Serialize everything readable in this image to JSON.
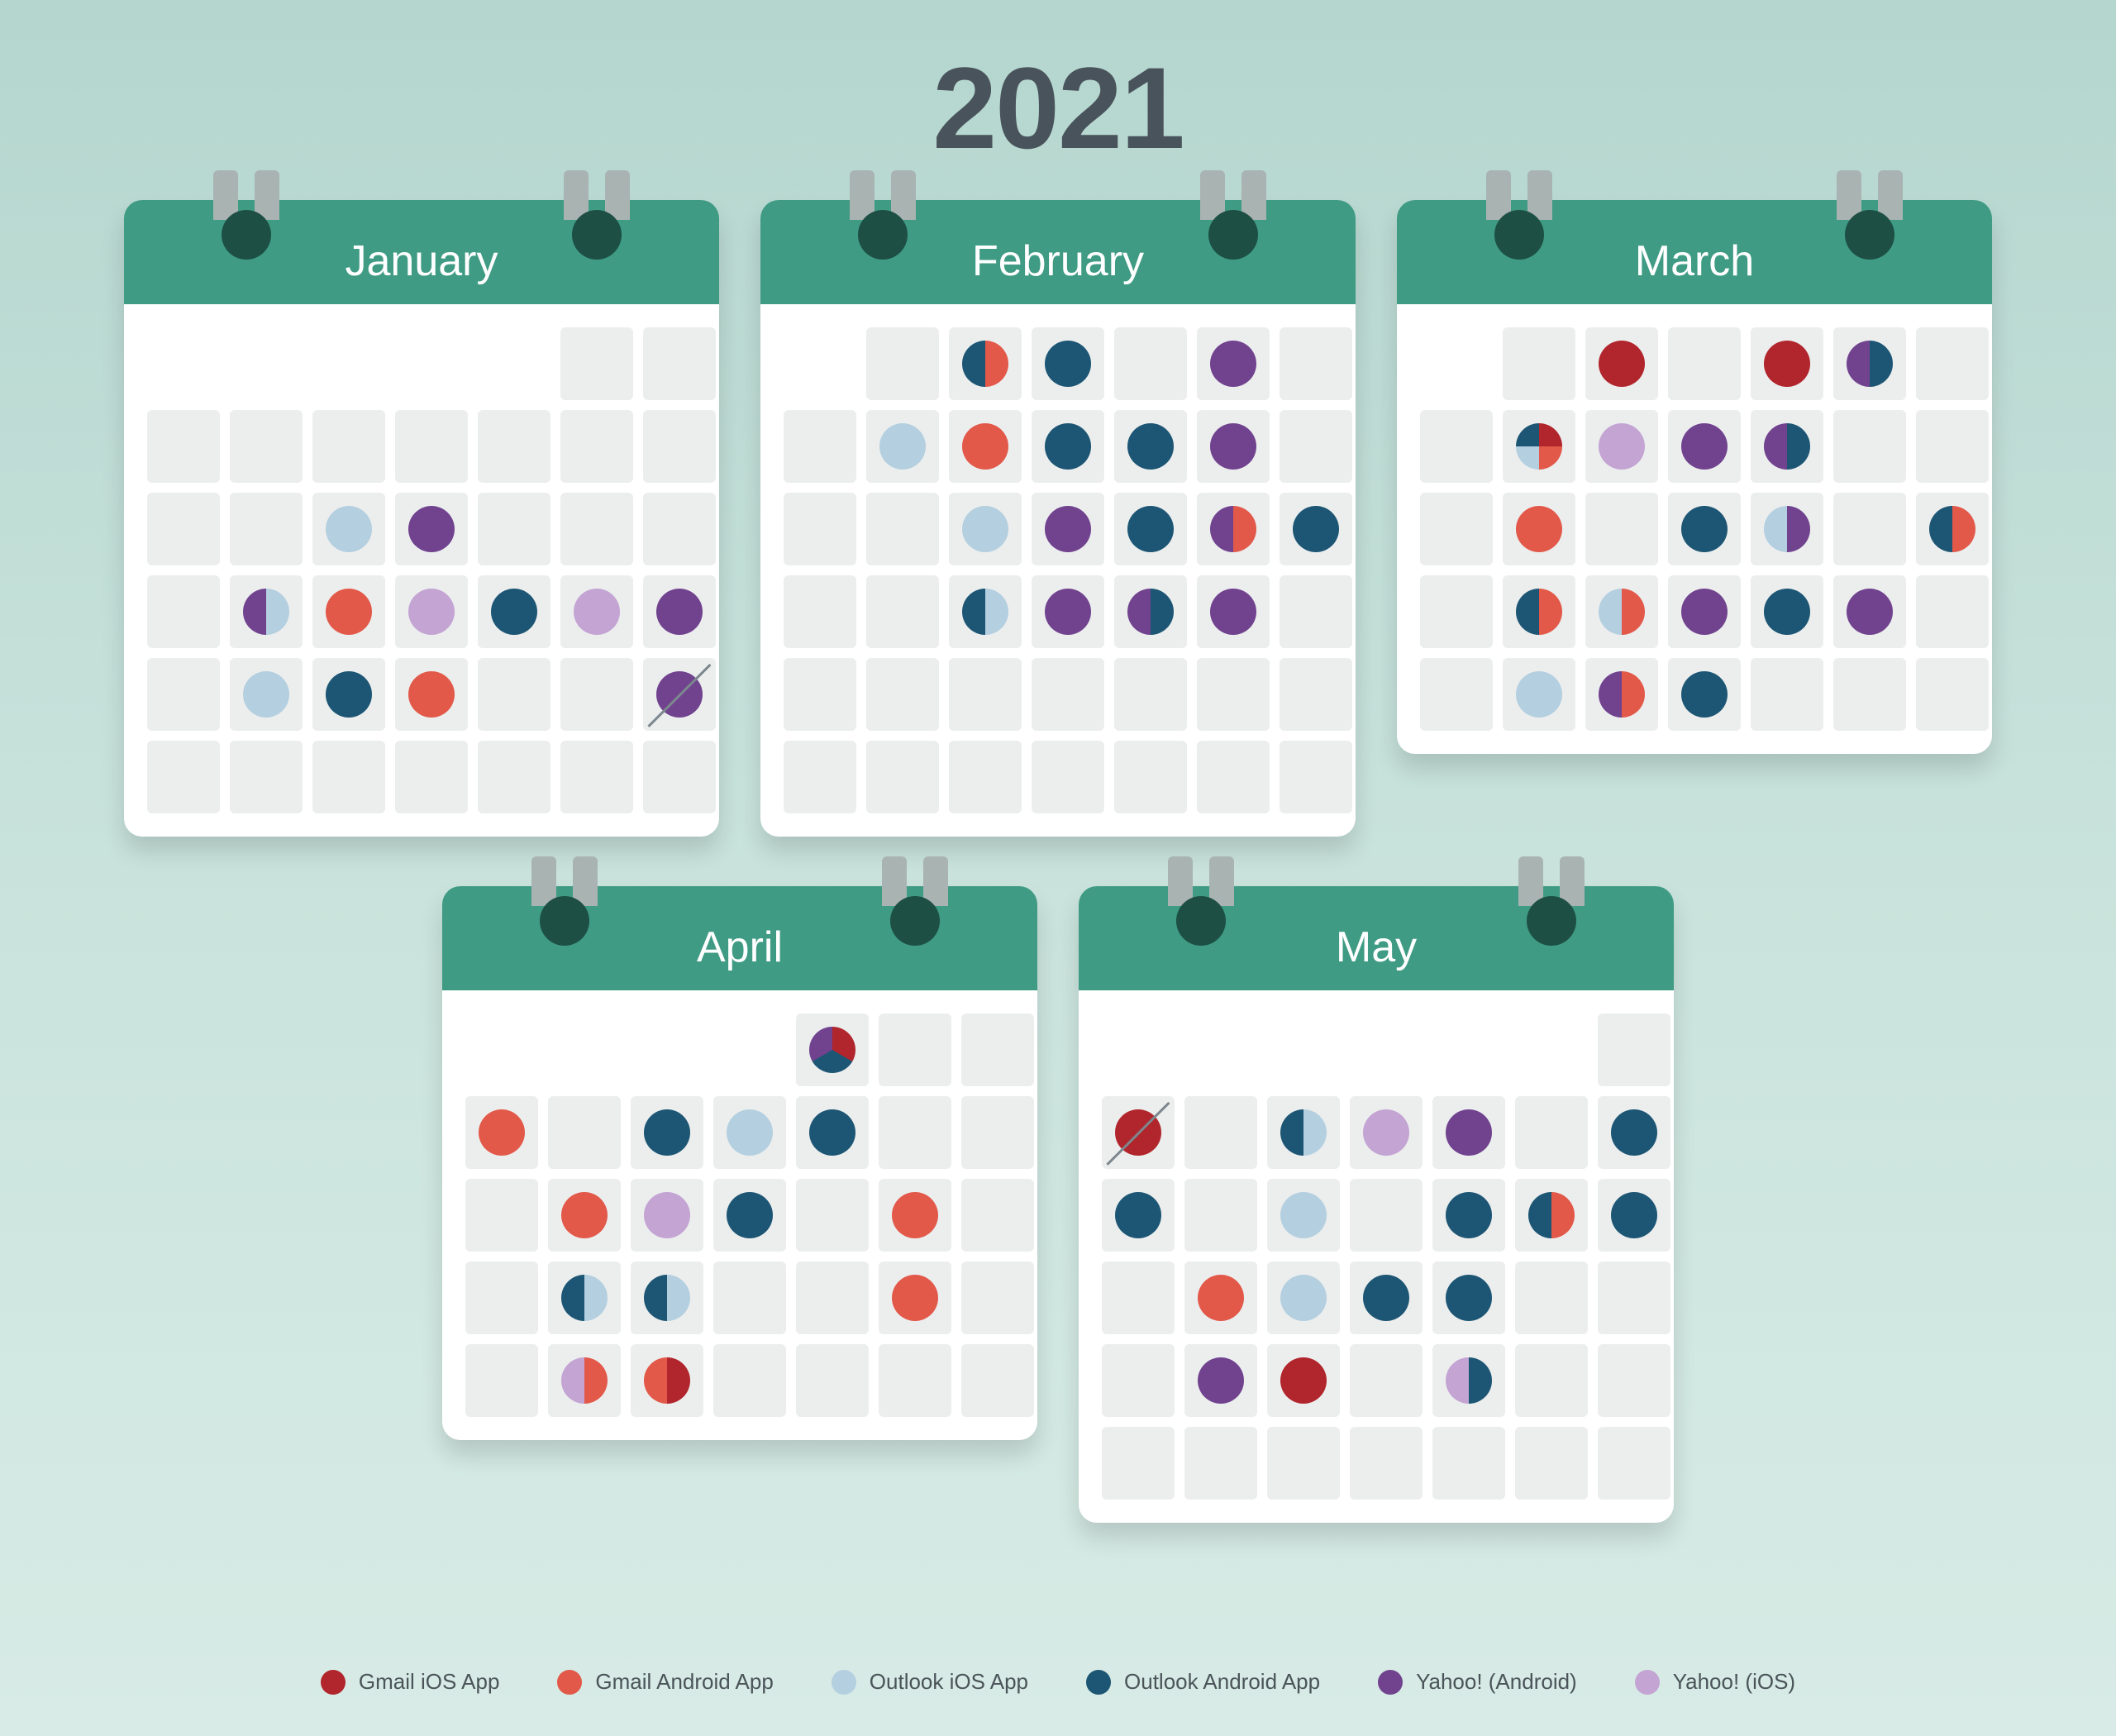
{
  "year": "2021",
  "colors": {
    "gmail_ios": "#b1252c",
    "gmail_android": "#e2594a",
    "outlook_ios": "#b4cfdf",
    "outlook_android": "#1d5674",
    "yahoo_android": "#71438f",
    "yahoo_ios": "#c3a4d3"
  },
  "legend": [
    {
      "key": "gmail_ios",
      "label": "Gmail iOS App"
    },
    {
      "key": "gmail_android",
      "label": "Gmail Android App"
    },
    {
      "key": "outlook_ios",
      "label": "Outlook iOS App"
    },
    {
      "key": "outlook_android",
      "label": "Outlook Android App"
    },
    {
      "key": "yahoo_android",
      "label": "Yahoo! (Android)"
    },
    {
      "key": "yahoo_ios",
      "label": "Yahoo! (iOS)"
    }
  ],
  "chart_data": {
    "type": "calendar-dot",
    "note": "Each month is a 6x7 grid (row-major, Sun-Sat). 'lead' = blank cells before day 1. Each day maps to an array of legend keys (empty = no-release blank cell). 'slash' marks a crossed-out day.",
    "months": [
      {
        "name": "January",
        "lead": 5,
        "days": {
          "1": [],
          "2": [],
          "3": [],
          "4": [],
          "5": [],
          "6": [],
          "7": [],
          "8": [],
          "9": [],
          "10": [],
          "11": [],
          "12": [
            "outlook_ios"
          ],
          "13": [
            "yahoo_android"
          ],
          "14": [],
          "15": [],
          "16": [],
          "17": [],
          "18": [
            "outlook_ios",
            "yahoo_android"
          ],
          "19": [
            "gmail_android"
          ],
          "20": [
            "yahoo_ios"
          ],
          "21": [
            "outlook_android"
          ],
          "22": [
            "yahoo_ios"
          ],
          "23": [
            "yahoo_android"
          ],
          "24": [],
          "25": [
            "outlook_ios"
          ],
          "26": [
            "outlook_android"
          ],
          "27": [
            "gmail_android"
          ],
          "28": [],
          "29": [],
          "30": [
            "yahoo_android"
          ]
        },
        "slash": [
          30
        ],
        "rows": 6
      },
      {
        "name": "February",
        "lead": 1,
        "days": {
          "1": [],
          "2": [
            "gmail_android",
            "outlook_android"
          ],
          "3": [
            "outlook_android"
          ],
          "4": [],
          "5": [
            "yahoo_android"
          ],
          "6": [],
          "7": [],
          "8": [
            "outlook_ios"
          ],
          "9": [
            "gmail_android"
          ],
          "10": [
            "outlook_android"
          ],
          "11": [
            "outlook_android"
          ],
          "12": [
            "yahoo_android"
          ],
          "13": [],
          "14": [],
          "15": [],
          "16": [
            "outlook_ios"
          ],
          "17": [
            "yahoo_android"
          ],
          "18": [
            "outlook_android"
          ],
          "19": [
            "gmail_android",
            "yahoo_android"
          ],
          "20": [
            "outlook_android"
          ],
          "21": [],
          "22": [],
          "23": [
            "outlook_ios",
            "outlook_android"
          ],
          "24": [
            "yahoo_android"
          ],
          "25": [
            "outlook_android",
            "yahoo_android"
          ],
          "26": [
            "yahoo_android"
          ],
          "27": [],
          "28": []
        },
        "rows": 6
      },
      {
        "name": "March",
        "lead": 1,
        "days": {
          "1": [],
          "2": [
            "gmail_ios"
          ],
          "3": [],
          "4": [
            "gmail_ios"
          ],
          "5": [
            "outlook_android",
            "yahoo_android"
          ],
          "6": [],
          "7": [],
          "8": [
            "gmail_ios",
            "gmail_android",
            "outlook_ios",
            "outlook_android"
          ],
          "9": [
            "yahoo_ios"
          ],
          "10": [
            "yahoo_android"
          ],
          "11": [
            "outlook_android",
            "yahoo_android"
          ],
          "12": [],
          "13": [],
          "14": [],
          "15": [
            "gmail_android"
          ],
          "16": [],
          "17": [
            "outlook_android"
          ],
          "18": [
            "yahoo_android",
            "outlook_ios"
          ],
          "19": [],
          "20": [
            "gmail_android",
            "outlook_android"
          ],
          "21": [],
          "22": [
            "gmail_android",
            "outlook_android"
          ],
          "23": [
            "gmail_android",
            "outlook_ios"
          ],
          "24": [
            "yahoo_android"
          ],
          "25": [
            "outlook_android"
          ],
          "26": [
            "yahoo_android"
          ],
          "27": [],
          "28": [],
          "29": [
            "outlook_ios"
          ],
          "30": [
            "gmail_android",
            "yahoo_android"
          ],
          "31": [
            "outlook_android"
          ]
        },
        "rows": 5
      },
      {
        "name": "April",
        "lead": 4,
        "days": {
          "1": [
            "gmail_ios",
            "outlook_android",
            "yahoo_android"
          ],
          "2": [],
          "3": [],
          "4": [
            "gmail_android"
          ],
          "5": [],
          "6": [
            "outlook_android"
          ],
          "7": [
            "outlook_ios"
          ],
          "8": [
            "outlook_android"
          ],
          "9": [],
          "10": [],
          "11": [],
          "12": [
            "gmail_android"
          ],
          "13": [
            "yahoo_ios"
          ],
          "14": [
            "outlook_android"
          ],
          "15": [],
          "16": [
            "gmail_android"
          ],
          "17": [],
          "18": [],
          "19": [
            "outlook_ios",
            "outlook_android"
          ],
          "20": [
            "outlook_ios",
            "outlook_android"
          ],
          "21": [],
          "22": [],
          "23": [
            "gmail_android"
          ],
          "24": [],
          "25": [],
          "26": [
            "gmail_android",
            "yahoo_ios"
          ],
          "27": [
            "gmail_ios",
            "gmail_android"
          ],
          "28": [],
          "29": [],
          "30": []
        },
        "rows": 5
      },
      {
        "name": "May",
        "lead": 6,
        "days": {
          "1": [],
          "2": [
            "gmail_ios"
          ],
          "3": [],
          "4": [
            "outlook_ios",
            "outlook_android"
          ],
          "5": [
            "yahoo_ios"
          ],
          "6": [
            "yahoo_android"
          ],
          "7": [],
          "8": [
            "outlook_android"
          ],
          "9": [
            "outlook_android"
          ],
          "10": [],
          "11": [
            "outlook_ios"
          ],
          "12": [],
          "13": [
            "outlook_android"
          ],
          "14": [
            "gmail_android",
            "outlook_android"
          ],
          "15": [
            "outlook_android"
          ],
          "16": [],
          "17": [
            "gmail_android"
          ],
          "18": [
            "outlook_ios"
          ],
          "19": [
            "outlook_android"
          ],
          "20": [
            "outlook_android"
          ],
          "21": [],
          "22": [],
          "23": [],
          "24": [
            "yahoo_android"
          ],
          "25": [
            "gmail_ios"
          ],
          "26": [],
          "27": [
            "outlook_android",
            "yahoo_ios"
          ],
          "28": [],
          "29": [],
          "30": [],
          "31": []
        },
        "slash": [
          2
        ],
        "rows": 6
      }
    ]
  }
}
